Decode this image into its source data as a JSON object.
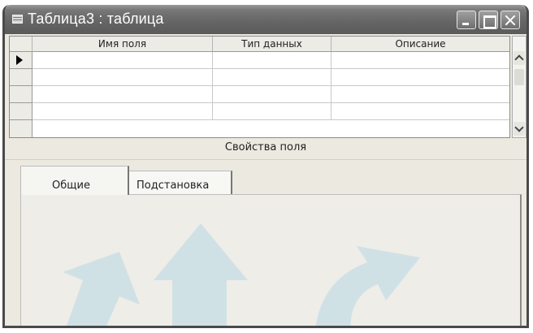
{
  "window": {
    "title": "Таблица3 : таблица",
    "icons": [
      "table-icon",
      "minimize-icon",
      "maximize-icon",
      "close-icon"
    ]
  },
  "grid": {
    "columns": [
      "Имя поля",
      "Тип данных",
      "Описание"
    ],
    "rows": [
      [
        "",
        "",
        ""
      ],
      [
        "",
        "",
        ""
      ],
      [
        "",
        "",
        ""
      ],
      [
        "",
        "",
        ""
      ]
    ],
    "current_row": 1
  },
  "properties": {
    "label": "Свойства поля",
    "tabs": [
      "Общие",
      "Подстановка"
    ],
    "active_tab": "Общие"
  },
  "colors": {
    "titlebar": "#6b6b6b",
    "window_bg": "#ece9e0",
    "watermark": "#b9d8e6"
  }
}
